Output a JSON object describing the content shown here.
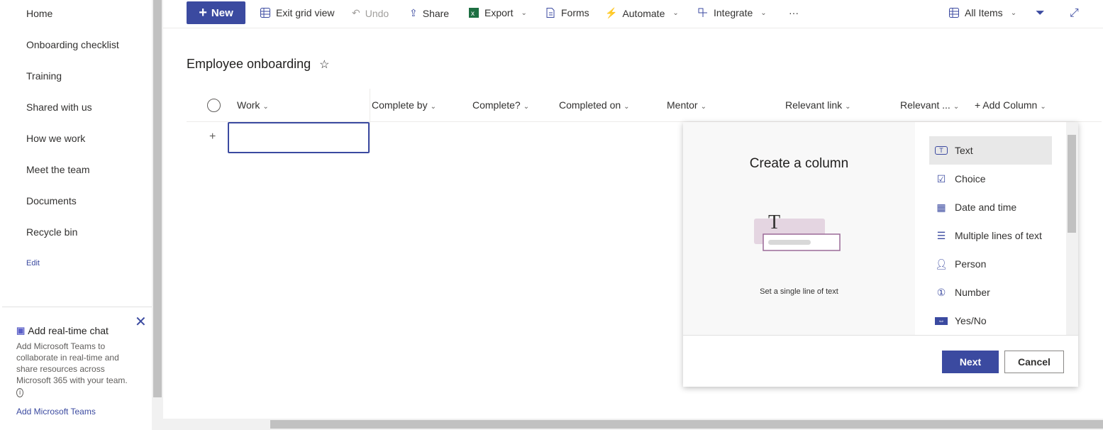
{
  "nav": {
    "items": [
      "Home",
      "Onboarding checklist",
      "Training",
      "Shared with us",
      "How we work",
      "Meet the team",
      "Documents",
      "Recycle bin"
    ],
    "edit": "Edit"
  },
  "card": {
    "title": "Add real-time chat",
    "body": "Add Microsoft Teams to collaborate in real-time and share resources across Microsoft 365 with your team.",
    "link": "Add Microsoft Teams"
  },
  "toolbar": {
    "new": "New",
    "exit_grid": "Exit grid view",
    "undo": "Undo",
    "share": "Share",
    "export": "Export",
    "forms": "Forms",
    "automate": "Automate",
    "integrate": "Integrate",
    "more": "···",
    "view": "All Items"
  },
  "list": {
    "title": "Employee onboarding",
    "columns": [
      "Work",
      "Complete by",
      "Complete?",
      "Completed on",
      "Mentor",
      "Relevant link",
      "Relevant ...",
      "+ Add Column"
    ],
    "add_row": "+"
  },
  "panel": {
    "title": "Create a column",
    "description": "Set a single line of text",
    "options": [
      {
        "label": "Text",
        "icon": "text-box-icon"
      },
      {
        "label": "Choice",
        "icon": "check-circle-icon"
      },
      {
        "label": "Date and time",
        "icon": "calendar-icon"
      },
      {
        "label": "Multiple lines of text",
        "icon": "lines-icon"
      },
      {
        "label": "Person",
        "icon": "person-icon"
      },
      {
        "label": "Number",
        "icon": "number-circle-icon"
      },
      {
        "label": "Yes/No",
        "icon": "toggle-icon"
      }
    ],
    "selected": "Text",
    "next": "Next",
    "cancel": "Cancel"
  },
  "colors": {
    "accent": "#3b4aa0"
  }
}
